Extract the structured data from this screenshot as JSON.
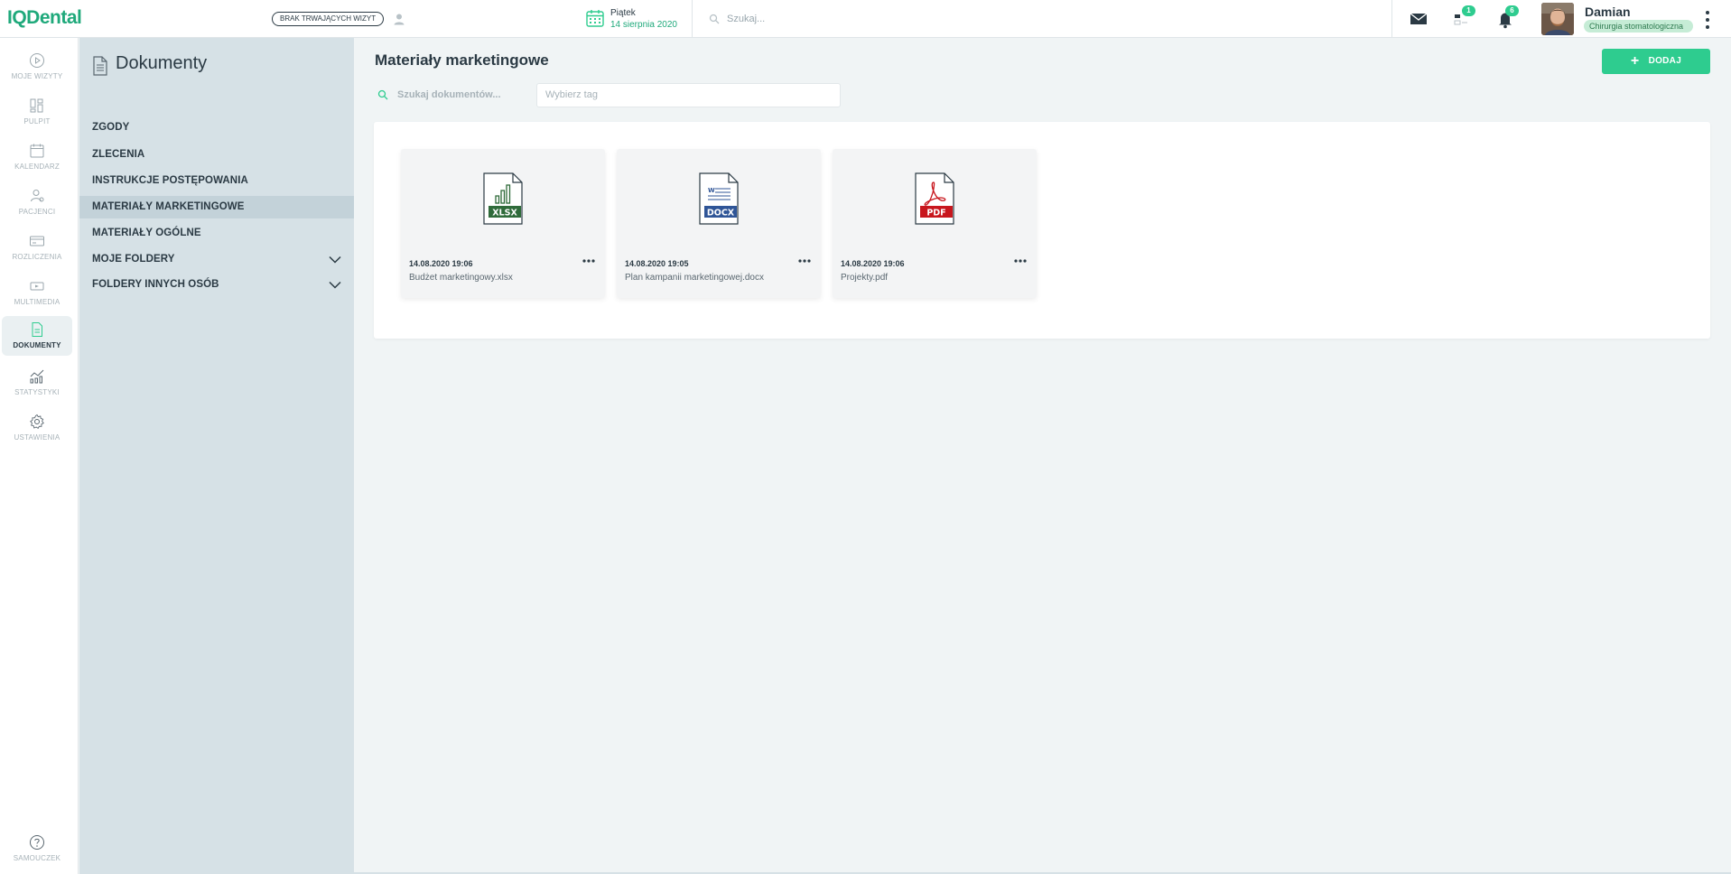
{
  "app": {
    "logo": "IQDental"
  },
  "header": {
    "visits_status": "BRAK TRWAJĄCYCH WIZYT",
    "date_day": "Piątek",
    "date_full": "14 sierpnia 2020",
    "search_placeholder": "Szukaj...",
    "tasks_badge": "1",
    "notifications_badge": "6",
    "user_name": "Damian",
    "user_role": "Chirurgia stomatologiczna"
  },
  "nav": {
    "items": [
      {
        "label": "MOJE WIZYTY",
        "icon": "play-circle-icon"
      },
      {
        "label": "PULPIT",
        "icon": "dashboard-icon"
      },
      {
        "label": "KALENDARZ",
        "icon": "calendar-icon"
      },
      {
        "label": "PACJENCI",
        "icon": "patients-icon"
      },
      {
        "label": "ROZLICZENIA",
        "icon": "card-icon"
      },
      {
        "label": "MULTIMEDIA",
        "icon": "multimedia-icon"
      },
      {
        "label": "DOKUMENTY",
        "icon": "document-icon",
        "active": true
      },
      {
        "label": "STATYSTYKI",
        "icon": "stats-icon"
      },
      {
        "label": "USTAWIENIA",
        "icon": "gear-icon"
      }
    ],
    "help_label": "SAMOUCZEK"
  },
  "documents": {
    "title": "Dokumenty",
    "folders": [
      {
        "label": "ZGODY"
      },
      {
        "label": "ZLECENIA"
      },
      {
        "label": "INSTRUKCJE POSTĘPOWANIA"
      },
      {
        "label": "MATERIAŁY MARKETINGOWE",
        "active": true
      },
      {
        "label": "MATERIAŁY OGÓLNE"
      },
      {
        "label": "MOJE FOLDERY",
        "expandable": true
      },
      {
        "label": "FOLDERY INNYCH OSÓB",
        "expandable": true
      }
    ]
  },
  "main": {
    "title": "Materiały marketingowe",
    "add_label": "DODAJ",
    "search_placeholder": "Szukaj dokumentów...",
    "tag_placeholder": "Wybierz tag",
    "files": [
      {
        "date": "14.08.2020 19:06",
        "name": "Budżet marketingowy.xlsx",
        "type": "XLSX",
        "color": "#2f6b3a"
      },
      {
        "date": "14.08.2020 19:05",
        "name": "Plan kampanii marketingowej.docx",
        "type": "DOCX",
        "color": "#2f5597"
      },
      {
        "date": "14.08.2020 19:06",
        "name": "Projekty.pdf",
        "type": "PDF",
        "color": "#c8161d"
      }
    ]
  },
  "colors": {
    "accent": "#2ecc8f",
    "brand": "#1fa97b",
    "panel": "#d6e1e6"
  }
}
